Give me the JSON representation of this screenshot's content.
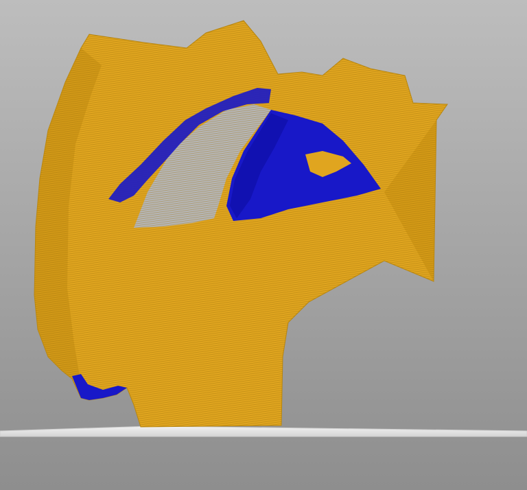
{
  "viewport": {
    "background_top": "#bdbdbd",
    "background_bottom": "#8e8e8e"
  },
  "model": {
    "surface_color": "#e0a51f",
    "surface_shadow": "#b8860f",
    "surface_highlight": "#f0be3a",
    "overhang_color": "#1818c8",
    "overhang_dark": "#0a0a9a"
  },
  "build_plate": {
    "color": "#e8e8e8",
    "edge_color": "#cfcfcf"
  }
}
